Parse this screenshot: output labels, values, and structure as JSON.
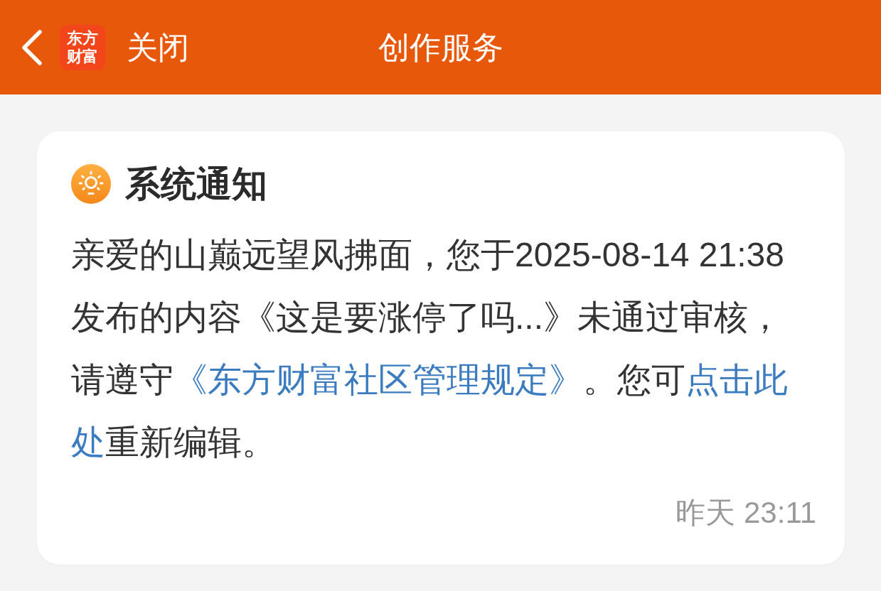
{
  "header": {
    "logo_text": [
      "东方",
      "财富"
    ],
    "close_label": "关闭",
    "title": "创作服务"
  },
  "notice": {
    "title": "系统通知",
    "body": [
      {
        "kind": "text",
        "text": "亲爱的山巅远望风拂面，您于2025-08-14 21:38发布的内容《这是要涨停了吗...》未通过审核，请遵守"
      },
      {
        "kind": "link",
        "text": "《东方财富社区管理规定》"
      },
      {
        "kind": "text",
        "text": "。您可"
      },
      {
        "kind": "link",
        "text": "点击此"
      },
      {
        "kind": "link",
        "text": "处"
      },
      {
        "kind": "text",
        "text": "重新编辑。"
      }
    ],
    "time": "昨天 23:11"
  }
}
